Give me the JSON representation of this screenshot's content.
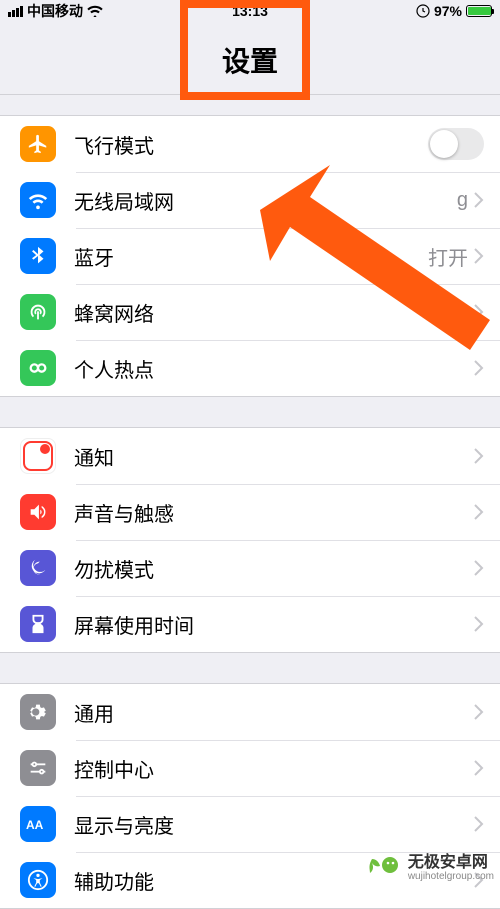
{
  "status": {
    "carrier": "中国移动",
    "time": "13:13",
    "battery_pct": "97%"
  },
  "header": {
    "title": "设置"
  },
  "rows": {
    "airplane": {
      "label": "飞行模式"
    },
    "wifi": {
      "label": "无线局域网",
      "value": "g"
    },
    "bluetooth": {
      "label": "蓝牙",
      "value": "打开"
    },
    "cellular": {
      "label": "蜂窝网络"
    },
    "hotspot": {
      "label": "个人热点"
    },
    "notify": {
      "label": "通知"
    },
    "sound": {
      "label": "声音与触感"
    },
    "dnd": {
      "label": "勿扰模式"
    },
    "screentime": {
      "label": "屏幕使用时间"
    },
    "general": {
      "label": "通用"
    },
    "control": {
      "label": "控制中心"
    },
    "display": {
      "label": "显示与亮度"
    },
    "access": {
      "label": "辅助功能"
    }
  },
  "watermark": {
    "name": "无极安卓网",
    "url": "wujihotelgroup.com"
  },
  "colors": {
    "highlight": "#ff5a0e",
    "ios_orange": "#ff9500",
    "ios_blue": "#007aff",
    "ios_green": "#34c759",
    "ios_red": "#ff3b30",
    "ios_purple": "#5856d6",
    "ios_gray": "#8e8e93"
  }
}
